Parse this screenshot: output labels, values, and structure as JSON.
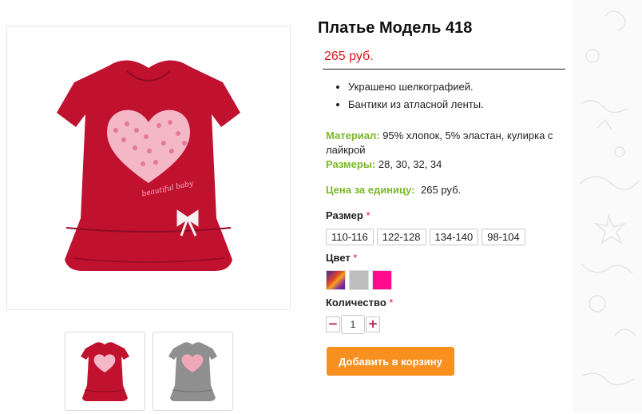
{
  "product": {
    "title": "Платье Модель 418",
    "price": "265 руб.",
    "features": [
      "Украшено шелкографией.",
      "Бантики из атласной ленты."
    ],
    "material_label": "Материал:",
    "material_value": "95% хлопок, 5% эластан, кулирка с лайкрой",
    "sizes_label": "Размеры:",
    "sizes_value": "28, 30, 32, 34",
    "unit_price_label": "Цена за единицу:",
    "unit_price_value": "265 руб.",
    "main_image": {
      "color": "#c0112f",
      "print_text": "beautiful baby"
    }
  },
  "thumbnails": [
    {
      "name": "thumbnail-red-dress",
      "color": "#c0112f"
    },
    {
      "name": "thumbnail-gray-dress",
      "color": "#8f8f8f"
    }
  ],
  "options": {
    "size": {
      "label": "Размер",
      "required_mark": "*",
      "values": [
        "110-116",
        "122-128",
        "134-140",
        "98-104"
      ]
    },
    "color": {
      "label": "Цвет",
      "required_mark": "*",
      "swatches": [
        "#multicolor",
        "#bdbdbd",
        "#ff0a8a"
      ]
    },
    "quantity": {
      "label": "Количество",
      "required_mark": "*",
      "value": "1",
      "minus": "−",
      "plus": "+"
    }
  },
  "add_to_cart_label": "Добавить в корзину",
  "colors": {
    "price": "#e0161d",
    "accent_green": "#7ab828",
    "button": "#f7901e"
  }
}
